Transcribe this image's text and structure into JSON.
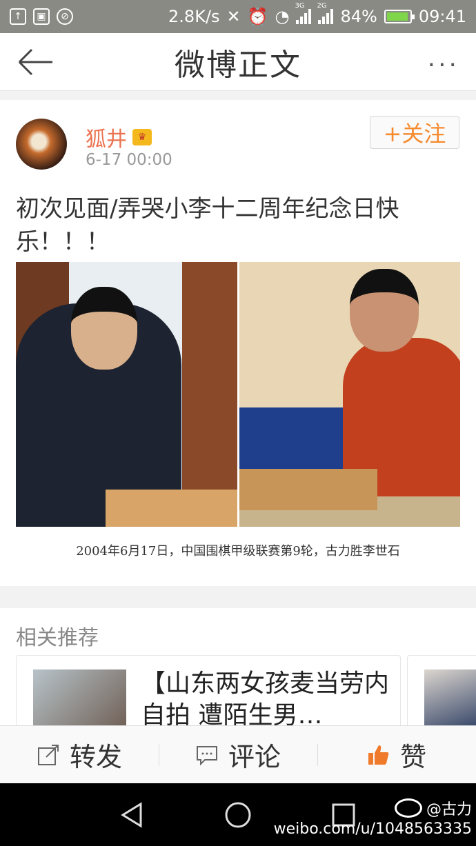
{
  "status_bar": {
    "speed": "2.8K/s",
    "net1": "3G",
    "net2": "2G",
    "battery": "84%",
    "battery_level": 0.84,
    "time": "09:41"
  },
  "nav": {
    "title": "微博正文",
    "back_icon": "back-arrow-icon",
    "more_label": "···"
  },
  "post": {
    "username": "狐井",
    "time": "6-17 00:00",
    "follow_label": "+关注",
    "text": "初次见面/弄哭小李十二周年纪念日快乐！！！",
    "image_caption": "2004年6月17日，中国围棋甲级联赛第9轮，古力胜李世石"
  },
  "related": {
    "title": "相关推荐",
    "items": [
      {
        "text": "【山东两女孩麦当劳内自拍 遭陌生男…"
      }
    ]
  },
  "actions": {
    "repost": "转发",
    "comment": "评论",
    "like": "赞",
    "like_color": "#f07a2c"
  },
  "watermark": {
    "handle": "@古力",
    "url": "weibo.com/u/1048563335"
  }
}
